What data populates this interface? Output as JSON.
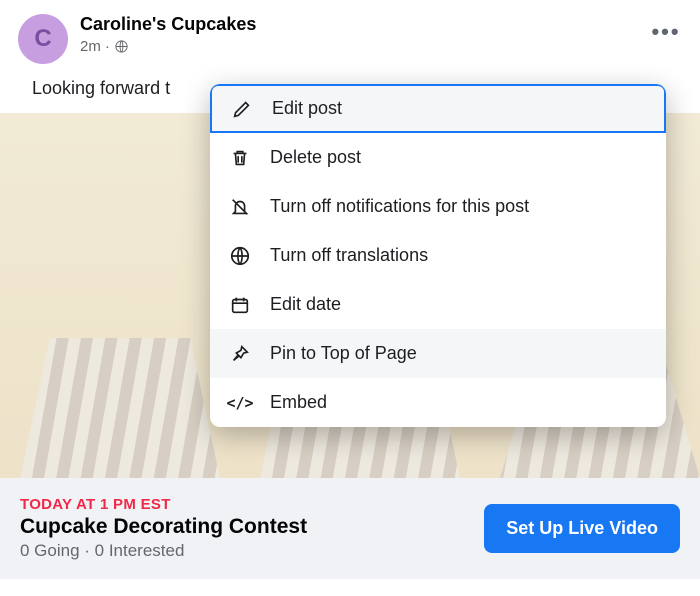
{
  "header": {
    "avatar_letter": "C",
    "author": "Caroline's Cupcakes",
    "timestamp": "2m",
    "separator": "·"
  },
  "post": {
    "body_visible": "Looking forward t"
  },
  "dropdown": {
    "items": [
      {
        "label": "Edit post"
      },
      {
        "label": "Delete post"
      },
      {
        "label": "Turn off notifications for this post"
      },
      {
        "label": "Turn off translations"
      },
      {
        "label": "Edit date"
      },
      {
        "label": "Pin to Top of Page"
      },
      {
        "label": "Embed"
      }
    ]
  },
  "event": {
    "time": "TODAY AT 1 PM EST",
    "title": "Cupcake Decorating Contest",
    "stats": "0 Going · 0 Interested",
    "cta": "Set Up Live Video"
  }
}
